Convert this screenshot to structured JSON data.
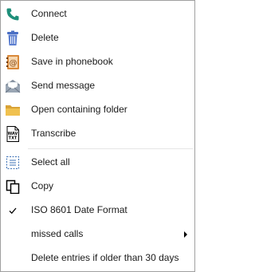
{
  "menu": {
    "items": [
      {
        "label": "Connect",
        "icon": "phone-icon"
      },
      {
        "label": "Delete",
        "icon": "trash-icon"
      },
      {
        "label": "Save in phonebook",
        "icon": "address-book-icon"
      },
      {
        "label": "Send message",
        "icon": "envelope-icon"
      },
      {
        "label": "Open containing folder",
        "icon": "folder-icon"
      },
      {
        "label": "Transcribe",
        "icon": "wav-txt-file-icon"
      },
      {
        "label": "Select all",
        "icon": "select-all-icon"
      },
      {
        "label": "Copy",
        "icon": "copy-icon"
      },
      {
        "label": "ISO 8601 Date Format",
        "icon": "checkmark-icon",
        "checked": true
      },
      {
        "label": "missed calls",
        "icon": "submenu-arrow-icon",
        "has_submenu": true
      },
      {
        "label": "Delete entries if older than 30 days"
      }
    ],
    "wav_icon_text": "WAV",
    "txt_icon_text": "TXT"
  },
  "colors": {
    "phone": "#1e8f7a",
    "trash": "#4a6fc4",
    "book": "#d9893a",
    "folder": "#e8b84a",
    "separator": "#e6e6e6"
  }
}
